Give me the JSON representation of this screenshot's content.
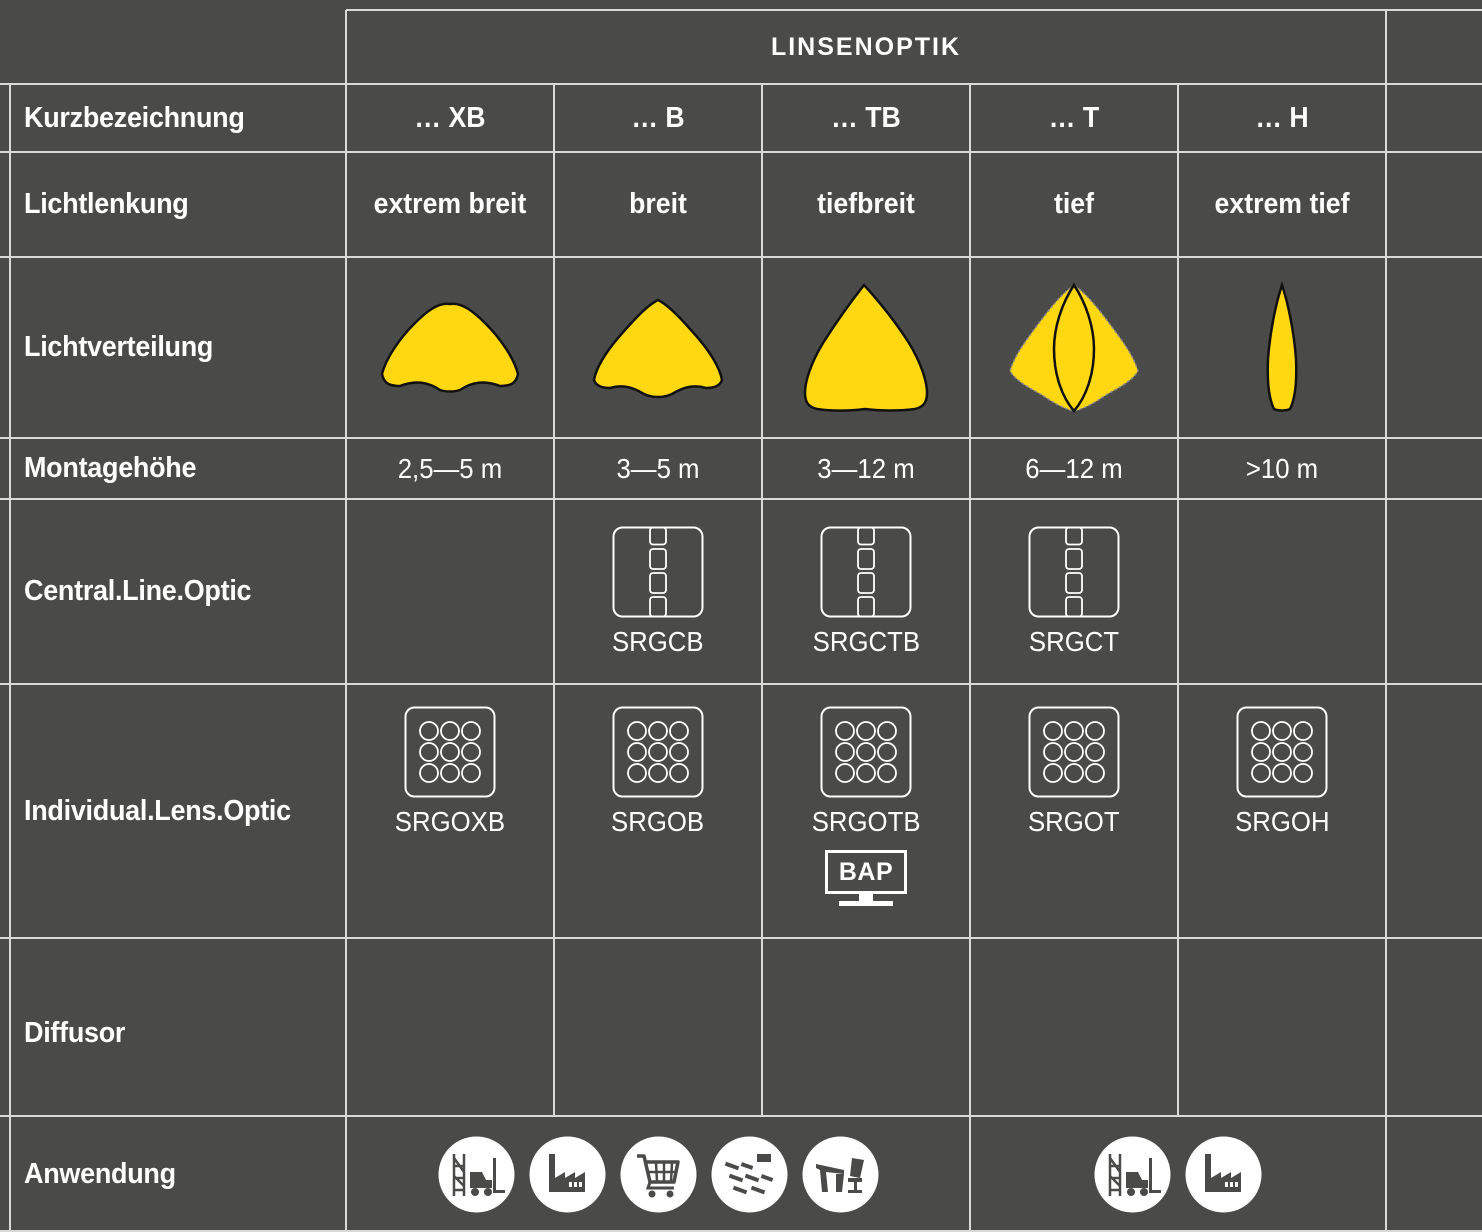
{
  "header": {
    "title": "LINSENOPTIK"
  },
  "row_labels": {
    "kurz": "Kurzbezeichnung",
    "lichtlenkung": "Lichtlenkung",
    "lichtverteilung": "Lichtverteilung",
    "montage": "Montagehöhe",
    "central": "Central.Line.Optic",
    "individual": "Individual.Lens.Optic",
    "diffusor": "Diffusor",
    "anwendung": "Anwendung"
  },
  "columns": [
    {
      "kurz": "… XB",
      "lichtlenkung": "extrem breit",
      "distribution": "extra-wide-distribution-icon",
      "montage": "2,5—5 m",
      "central": "",
      "individual": "SRGOXB"
    },
    {
      "kurz": "… B",
      "lichtlenkung": "breit",
      "distribution": "wide-distribution-icon",
      "montage": "3—5 m",
      "central": "SRGCB",
      "individual": "SRGOB"
    },
    {
      "kurz": "… TB",
      "lichtlenkung": "tiefbreit",
      "distribution": "deep-wide-distribution-icon",
      "montage": "3—12 m",
      "central": "SRGCTB",
      "individual": "SRGOTB",
      "badge": "BAP"
    },
    {
      "kurz": "… T",
      "lichtlenkung": "tief",
      "distribution": "deep-distribution-icon",
      "montage": "6—12 m",
      "central": "SRGCT",
      "individual": "SRGOT"
    },
    {
      "kurz": "… H",
      "lichtlenkung": "extrem tief",
      "distribution": "extra-deep-distribution-icon",
      "montage": ">10 m",
      "central": "",
      "individual": "SRGOH"
    }
  ],
  "anwendung": {
    "group1": [
      "warehouse-forklift-icon",
      "factory-icon",
      "shopping-cart-icon",
      "classroom-desks-icon",
      "office-desk-icon"
    ],
    "group2": [
      "warehouse-forklift-icon",
      "factory-icon"
    ]
  },
  "colors": {
    "background": "#4a4a48",
    "grid": "#d9d9d9",
    "beam": "#ffd811"
  }
}
